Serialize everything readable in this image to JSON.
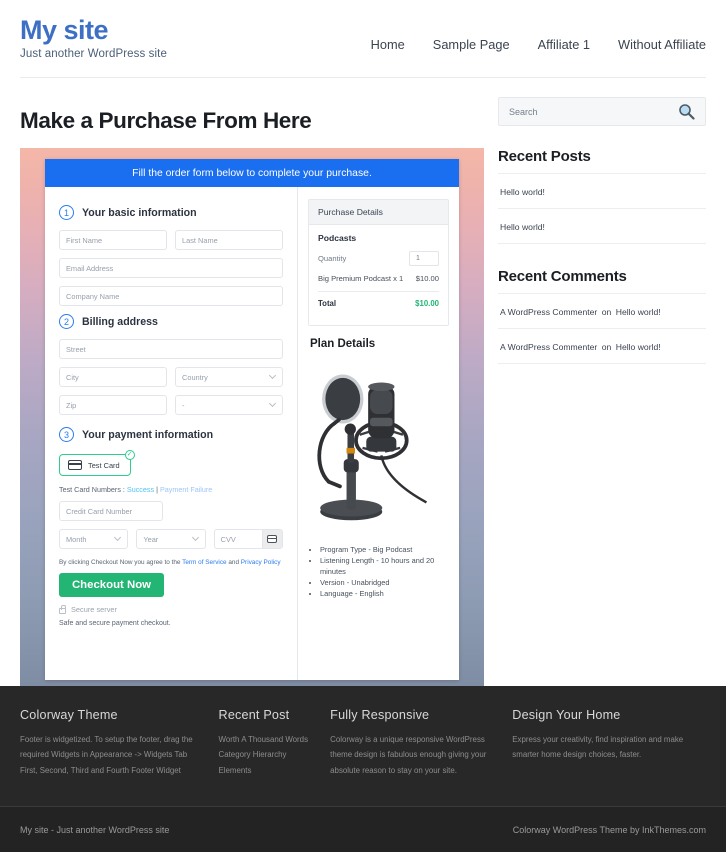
{
  "header": {
    "site_title": "My site",
    "tagline": "Just another WordPress site",
    "nav": [
      {
        "label": "Home"
      },
      {
        "label": "Sample Page"
      },
      {
        "label": "Affiliate 1"
      },
      {
        "label": "Without Affiliate"
      }
    ]
  },
  "main": {
    "page_title": "Make a Purchase From Here",
    "order_form": {
      "banner": "Fill the order form below to complete your purchase.",
      "steps": [
        {
          "num": "1",
          "label": "Your basic information"
        },
        {
          "num": "2",
          "label": "Billing address"
        },
        {
          "num": "3",
          "label": "Your payment information"
        }
      ],
      "fields": {
        "first_name": "First Name",
        "last_name": "Last Name",
        "email": "Email Address",
        "company": "Company Name",
        "street": "Street",
        "city": "City",
        "country": "Country",
        "zip": "Zip",
        "state": "-",
        "credit_card": "Credit Card Number",
        "month": "Month",
        "year": "Year",
        "cvv": "CVV"
      },
      "test_card_chip": "Test  Card",
      "test_numbers_label": "Test Card Numbers :",
      "test_numbers_success": "Success",
      "test_numbers_divider": "|",
      "test_numbers_failure": "Payment Failure",
      "terms_prefix": "By clicking Checkout Now you agree to the",
      "terms_service": "Term of Service",
      "terms_and": "and",
      "terms_privacy": "Privacy Policy",
      "checkout_button": "Checkout Now",
      "secure_server": "Secure server",
      "safe_text": "Safe and secure payment checkout."
    },
    "purchase_details": {
      "heading": "Purchase Details",
      "product": "Podcasts",
      "quantity_label": "Quantity",
      "quantity_value": "1",
      "line_item": "Big Premium Podcast x 1",
      "line_price": "$10.00",
      "total_label": "Total",
      "total_value": "$10.00"
    },
    "plan_details": {
      "title": "Plan Details",
      "features": [
        "Program Type - Big Podcast",
        "Listening Length - 10 hours and 20 minutes",
        "Version - Unabridged",
        "Language - English"
      ]
    }
  },
  "sidebar": {
    "search_placeholder": "Search",
    "recent_posts": {
      "title": "Recent Posts",
      "items": [
        "Hello world!",
        "Hello world!"
      ]
    },
    "recent_comments": {
      "title": "Recent Comments",
      "items": [
        {
          "author": "A WordPress Commenter",
          "on": "on",
          "post": "Hello world!"
        },
        {
          "author": "A WordPress Commenter",
          "on": "on",
          "post": "Hello world!"
        }
      ]
    }
  },
  "footer": {
    "columns": [
      {
        "title": "Colorway Theme",
        "text": "Footer is widgetized. To setup the footer, drag the required Widgets in Appearance -> Widgets Tab First, Second, Third and Fourth Footer Widget"
      },
      {
        "title": "Recent Post",
        "links": [
          "Worth A Thousand Words",
          "Category Hierarchy",
          "Elements"
        ]
      },
      {
        "title": "Fully Responsive",
        "text": "Colorway is a unique responsive WordPress theme design is fabulous enough giving your absolute reason to stay on your site."
      },
      {
        "title": "Design Your Home",
        "text": "Express your creativity, find inspiration and make smarter home design choices, faster."
      }
    ],
    "bottom_left": "My site - Just another WordPress site",
    "bottom_right": "Colorway WordPress Theme by InkThemes.com"
  },
  "colors": {
    "brand_blue": "#3d6fc4",
    "banner_blue": "#1a6ef0",
    "accent_green": "#22b573",
    "chip_green": "#2ecc8f",
    "link_blue": "#2b7cf0",
    "footer_bg": "#282828"
  }
}
